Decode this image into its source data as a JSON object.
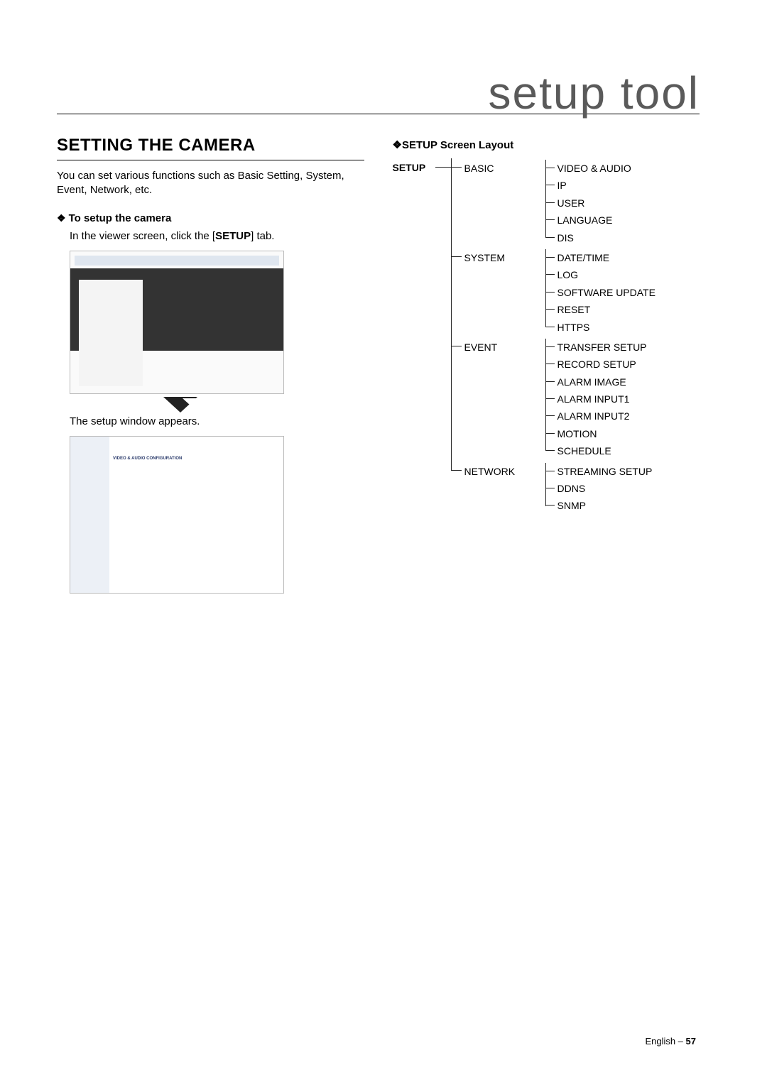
{
  "brand": "setup tool",
  "left": {
    "title": "SETTING THE CAMERA",
    "intro": "You can set various functions such as Basic Setting, System, Event, Network, etc.",
    "sub1": "To setup the camera",
    "step1a": "In the viewer screen, click the [",
    "step1b": "SETUP",
    "step1c": "] tab.",
    "step2": "The setup window appears.",
    "shot2_strip": "VIDEO & AUDIO CONFIGURATION"
  },
  "right": {
    "heading": "SETUP Screen Layout",
    "root": "SETUP",
    "tree": [
      {
        "label": "BASIC",
        "items": [
          "VIDEO & AUDIO",
          "IP",
          "USER",
          "LANGUAGE",
          "DIS"
        ]
      },
      {
        "label": "SYSTEM",
        "items": [
          "DATE/TIME",
          "LOG",
          "SOFTWARE UPDATE",
          "RESET",
          "HTTPS"
        ]
      },
      {
        "label": "EVENT",
        "items": [
          "TRANSFER SETUP",
          "RECORD SETUP",
          "ALARM IMAGE",
          "ALARM INPUT1",
          "ALARM INPUT2",
          "MOTION",
          "SCHEDULE"
        ]
      },
      {
        "label": "NETWORK",
        "items": [
          "STREAMING SETUP",
          "DDNS",
          "SNMP"
        ]
      }
    ]
  },
  "footer": {
    "lang": "English – ",
    "page": "57"
  }
}
